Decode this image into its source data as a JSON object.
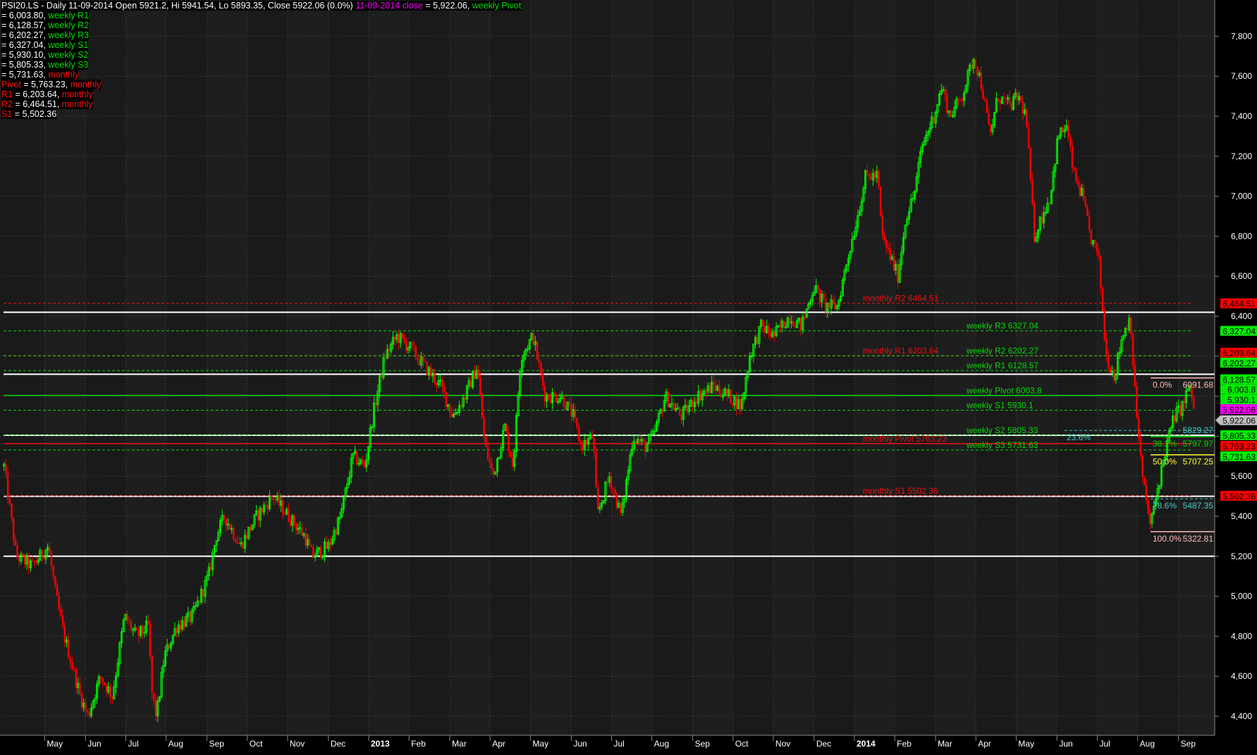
{
  "header": {
    "title": "PSI20.LS - Daily 11-09-2014 Open 5921.2, Hi 5941.54, Lo 5893.35, Close 5922.06 (0.0%)",
    "close_label": "11-09-2014 close",
    "close_value": " = 5,922.06, ",
    "close_suffix": "weekly Pivot"
  },
  "legend_rows": [
    {
      "prefix": "",
      "value": " = 6,003.80, ",
      "suffix": "weekly R1",
      "color": "g"
    },
    {
      "prefix": "",
      "value": " = 6,128.57, ",
      "suffix": "weekly R2",
      "color": "g"
    },
    {
      "prefix": "",
      "value": " = 6,202.27, ",
      "suffix": "weekly R3",
      "color": "g"
    },
    {
      "prefix": "",
      "value": " = 6,327.04, ",
      "suffix": "weekly S1",
      "color": "g"
    },
    {
      "prefix": "",
      "value": " = 5,930.10, ",
      "suffix": "weekly S2",
      "color": "g"
    },
    {
      "prefix": "",
      "value": " = 5,805.33, ",
      "suffix": "weekly S3",
      "color": "g"
    },
    {
      "prefix": "",
      "value": " = 5,731.63, ",
      "suffix": "monthly",
      "color": "r"
    },
    {
      "prefix": "Pivot",
      "value": " = 5,763.23, ",
      "suffix": "monthly",
      "color": "r"
    },
    {
      "prefix": "R1",
      "value": " = 6,203.64, ",
      "suffix": "monthly",
      "color": "r"
    },
    {
      "prefix": "R2",
      "value": " = 6,464.51, ",
      "suffix": "monthly",
      "color": "r"
    },
    {
      "prefix": "S1",
      "value": " = 5,502.36",
      "suffix": "",
      "color": "r"
    }
  ],
  "colors": {
    "up": "#00ff00",
    "down": "#ff0000",
    "background": "#1a1a1a",
    "grid": "#555555",
    "weekly": "#00dd00",
    "monthly": "#ee1111",
    "fib_cyan": "#44cccc",
    "fib_yellow": "#ffff33",
    "fib_pink": "#ffbbbb"
  },
  "chart_data": {
    "type": "candlestick",
    "title": "PSI20.LS - Daily",
    "ylim": [
      4300,
      7900
    ],
    "yticks": [
      "4,400",
      "4,600",
      "4,800",
      "5,000",
      "5,200",
      "5,400",
      "5,600",
      "5,800",
      "6,000",
      "6,200",
      "6,400",
      "6,600",
      "6,800",
      "7,000",
      "7,200",
      "7,400",
      "7,600",
      "7,800"
    ],
    "ytick_values": [
      4400,
      4600,
      4800,
      5000,
      5200,
      5400,
      5600,
      5800,
      6000,
      6200,
      6400,
      6600,
      6800,
      7000,
      7200,
      7400,
      7600,
      7800
    ],
    "xlim": [
      2012.22,
      2014.7
    ],
    "xticks": [
      {
        "label": "May",
        "t": 2012.333
      },
      {
        "label": "Jun",
        "t": 2012.417
      },
      {
        "label": "Jul",
        "t": 2012.5
      },
      {
        "label": "Aug",
        "t": 2012.583
      },
      {
        "label": "Sep",
        "t": 2012.667
      },
      {
        "label": "Oct",
        "t": 2012.75
      },
      {
        "label": "Nov",
        "t": 2012.833
      },
      {
        "label": "Dec",
        "t": 2012.917
      },
      {
        "label": "2013",
        "t": 2013.0,
        "bold": true
      },
      {
        "label": "Feb",
        "t": 2013.083
      },
      {
        "label": "Mar",
        "t": 2013.167
      },
      {
        "label": "Apr",
        "t": 2013.25
      },
      {
        "label": "May",
        "t": 2013.333
      },
      {
        "label": "Jun",
        "t": 2013.417
      },
      {
        "label": "Jul",
        "t": 2013.5
      },
      {
        "label": "Aug",
        "t": 2013.583
      },
      {
        "label": "Sep",
        "t": 2013.667
      },
      {
        "label": "Oct",
        "t": 2013.75
      },
      {
        "label": "Nov",
        "t": 2013.833
      },
      {
        "label": "Dec",
        "t": 2013.917
      },
      {
        "label": "2014",
        "t": 2014.0,
        "bold": true
      },
      {
        "label": "Feb",
        "t": 2014.083
      },
      {
        "label": "Mar",
        "t": 2014.167
      },
      {
        "label": "Apr",
        "t": 2014.25
      },
      {
        "label": "May",
        "t": 2014.333
      },
      {
        "label": "Jun",
        "t": 2014.417
      },
      {
        "label": "Jul",
        "t": 2014.5
      },
      {
        "label": "Aug",
        "t": 2014.583
      },
      {
        "label": "Sep",
        "t": 2014.667
      }
    ],
    "price_path": [
      [
        2012.226,
        5650
      ],
      [
        2012.251,
        5200
      ],
      [
        2012.284,
        5150
      ],
      [
        2012.317,
        5250
      ],
      [
        2012.333,
        5000
      ],
      [
        2012.35,
        4800
      ],
      [
        2012.383,
        4500
      ],
      [
        2012.399,
        4400
      ],
      [
        2012.424,
        4600
      ],
      [
        2012.449,
        4500
      ],
      [
        2012.474,
        4900
      ],
      [
        2012.498,
        4800
      ],
      [
        2012.523,
        4850
      ],
      [
        2012.531,
        4500
      ],
      [
        2012.54,
        4400
      ],
      [
        2012.556,
        4700
      ],
      [
        2012.581,
        4850
      ],
      [
        2012.614,
        4900
      ],
      [
        2012.647,
        5100
      ],
      [
        2012.663,
        5300
      ],
      [
        2012.68,
        5400
      ],
      [
        2012.713,
        5250
      ],
      [
        2012.746,
        5400
      ],
      [
        2012.779,
        5500
      ],
      [
        2012.812,
        5400
      ],
      [
        2012.845,
        5300
      ],
      [
        2012.861,
        5200
      ],
      [
        2012.894,
        5250
      ],
      [
        2012.919,
        5400
      ],
      [
        2012.944,
        5700
      ],
      [
        2012.969,
        5650
      ],
      [
        2012.985,
        5900
      ],
      [
        2013.01,
        6200
      ],
      [
        2013.035,
        6300
      ],
      [
        2013.059,
        6250
      ],
      [
        2013.092,
        6150
      ],
      [
        2013.125,
        6050
      ],
      [
        2013.15,
        5900
      ],
      [
        2013.175,
        6000
      ],
      [
        2013.2,
        6150
      ],
      [
        2013.216,
        5750
      ],
      [
        2013.233,
        5600
      ],
      [
        2013.257,
        5850
      ],
      [
        2013.274,
        5650
      ],
      [
        2013.29,
        6200
      ],
      [
        2013.315,
        6300
      ],
      [
        2013.34,
        6000
      ],
      [
        2013.373,
        6000
      ],
      [
        2013.398,
        5900
      ],
      [
        2013.414,
        5750
      ],
      [
        2013.439,
        5800
      ],
      [
        2013.447,
        5400
      ],
      [
        2013.472,
        5600
      ],
      [
        2013.497,
        5400
      ],
      [
        2013.521,
        5800
      ],
      [
        2013.546,
        5750
      ],
      [
        2013.563,
        5800
      ],
      [
        2013.587,
        6000
      ],
      [
        2013.62,
        5900
      ],
      [
        2013.653,
        6000
      ],
      [
        2013.686,
        6050
      ],
      [
        2013.719,
        6000
      ],
      [
        2013.744,
        5950
      ],
      [
        2013.761,
        6200
      ],
      [
        2013.785,
        6350
      ],
      [
        2013.81,
        6300
      ],
      [
        2013.843,
        6400
      ],
      [
        2013.868,
        6350
      ],
      [
        2013.893,
        6550
      ],
      [
        2013.917,
        6450
      ],
      [
        2013.942,
        6450
      ],
      [
        2013.959,
        6650
      ],
      [
        2013.983,
        6900
      ],
      [
        2014.0,
        7100
      ],
      [
        2014.025,
        7100
      ],
      [
        2014.033,
        6800
      ],
      [
        2014.05,
        6700
      ],
      [
        2014.066,
        6600
      ],
      [
        2014.083,
        6900
      ],
      [
        2014.099,
        7000
      ],
      [
        2014.116,
        7250
      ],
      [
        2014.14,
        7400
      ],
      [
        2014.157,
        7550
      ],
      [
        2014.173,
        7400
      ],
      [
        2014.198,
        7500
      ],
      [
        2014.223,
        7700
      ],
      [
        2014.239,
        7550
      ],
      [
        2014.256,
        7300
      ],
      [
        2014.272,
        7500
      ],
      [
        2014.297,
        7450
      ],
      [
        2014.314,
        7500
      ],
      [
        2014.33,
        7400
      ],
      [
        2014.347,
        6800
      ],
      [
        2014.363,
        6900
      ],
      [
        2014.38,
        7000
      ],
      [
        2014.396,
        7300
      ],
      [
        2014.413,
        7350
      ],
      [
        2014.429,
        7100
      ],
      [
        2014.446,
        7000
      ],
      [
        2014.462,
        6800
      ],
      [
        2014.479,
        6700
      ],
      [
        2014.495,
        6200
      ],
      [
        2014.512,
        6100
      ],
      [
        2014.528,
        6300
      ],
      [
        2014.545,
        6400
      ],
      [
        2014.553,
        6050
      ],
      [
        2014.569,
        5600
      ],
      [
        2014.586,
        5350
      ],
      [
        2014.602,
        5550
      ],
      [
        2014.619,
        5750
      ],
      [
        2014.635,
        5900
      ],
      [
        2014.652,
        5950
      ],
      [
        2014.665,
        6050
      ],
      [
        2014.678,
        5922
      ]
    ],
    "horizontal_lines": [
      6420,
      6110,
      5805,
      5500,
      5200
    ],
    "levels": [
      {
        "label": "monthly R2 6464.51",
        "value": 6464.51,
        "kind": "monthly",
        "style": "dashed"
      },
      {
        "label": "monthly R1 6203.64",
        "value": 6203.64,
        "kind": "monthly",
        "style": "dashed"
      },
      {
        "label": "monthly Pivot  5763.23",
        "value": 5763.23,
        "kind": "monthly",
        "style": "solid"
      },
      {
        "label": "monthly S1 5502.36",
        "value": 5502.36,
        "kind": "monthly",
        "style": "dashed"
      },
      {
        "label": "weekly R3 6327.04",
        "value": 6327.04,
        "kind": "weekly",
        "style": "dashed"
      },
      {
        "label": "weekly R2 6202.27",
        "value": 6202.27,
        "kind": "weekly",
        "style": "dashed"
      },
      {
        "label": "weekly R1  6128.57",
        "value": 6128.57,
        "kind": "weekly",
        "style": "dashed"
      },
      {
        "label": "weekly Pivot  6003.8",
        "value": 6003.8,
        "kind": "weekly",
        "style": "solid"
      },
      {
        "label": "weekly S1 5930.1",
        "value": 5930.1,
        "kind": "weekly",
        "style": "dashed"
      },
      {
        "label": "weekly S2 5805.33",
        "value": 5805.33,
        "kind": "weekly",
        "style": "dashed"
      },
      {
        "label": "weekly S3 5731.63",
        "value": 5731.63,
        "kind": "weekly",
        "style": "dashed"
      }
    ],
    "fibonacci": [
      {
        "pct": "0.0%",
        "value": "6091.68",
        "level": 6091.68,
        "color": "fib_pink"
      },
      {
        "pct": "23.6%",
        "value": "5829.27",
        "level": 5829.27,
        "color": "fib_cyan"
      },
      {
        "pct": "38.2%",
        "value": "5797.97",
        "level": 5797.97,
        "color": "weekly"
      },
      {
        "pct": "50.0%",
        "value": "5707.25",
        "level": 5707.25,
        "color": "fib_yellow"
      },
      {
        "pct": "78.6%",
        "value": "5487.35",
        "level": 5487.35,
        "color": "fib_cyan"
      },
      {
        "pct": "100.0%",
        "value": "5322.81",
        "level": 5322.81,
        "color": "fib_pink"
      }
    ],
    "right_markers": [
      {
        "text": "6,464.51",
        "value": 6464.51,
        "bg": "#ff0000",
        "fg": "#000"
      },
      {
        "text": "6,327.04",
        "value": 6327.04,
        "bg": "#00ee00",
        "fg": "#000"
      },
      {
        "text": "6,203.64",
        "value": 6218,
        "bg": "#ff0000",
        "fg": "#000"
      },
      {
        "text": "6,202.27",
        "value": 6168,
        "bg": "#00ee00",
        "fg": "#000"
      },
      {
        "text": "6,128.57",
        "value": 6085,
        "bg": "#00ee00",
        "fg": "#000"
      },
      {
        "text": "6,003.8",
        "value": 6035,
        "bg": "#00ee00",
        "fg": "#000"
      },
      {
        "text": "5,930.1",
        "value": 5985,
        "bg": "#00ee00",
        "fg": "#000"
      },
      {
        "text": "5,922.06",
        "value": 5935,
        "bg": "#ff00ff",
        "fg": "#000"
      },
      {
        "text": "5,922.06",
        "value": 5880,
        "bg": "#c0c0c0",
        "fg": "#000",
        "arrow": true
      },
      {
        "text": "5,805.33",
        "value": 5805.33,
        "bg": "#00ee00",
        "fg": "#000"
      },
      {
        "text": "5,763.23",
        "value": 5752,
        "bg": "#ff0000",
        "fg": "#000"
      },
      {
        "text": "5,731.63",
        "value": 5700,
        "bg": "#00ee00",
        "fg": "#000"
      },
      {
        "text": "5,502.36",
        "value": 5502.36,
        "bg": "#ff0000",
        "fg": "#000"
      }
    ]
  }
}
